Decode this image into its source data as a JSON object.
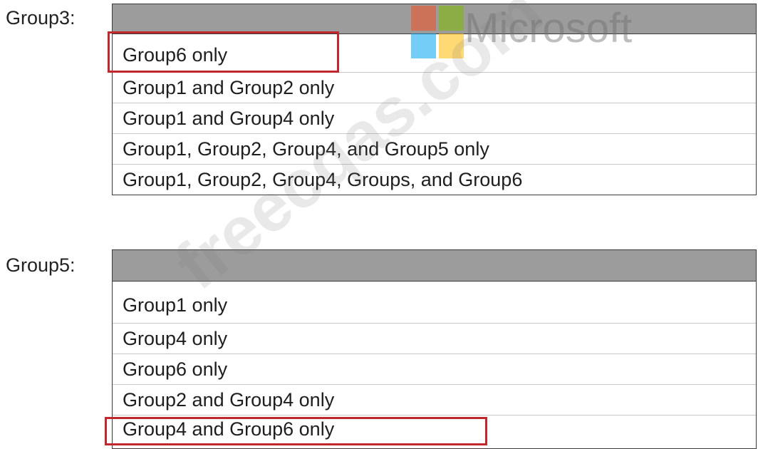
{
  "groups": [
    {
      "label": "Group3:",
      "options": [
        "Group6 only",
        "Group1 and Group2 only",
        "Group1 and Group4 only",
        "Group1, Group2, Group4, and Group5 only",
        "Group1, Group2, Group4, Groups, and Group6"
      ],
      "selected": "Group6 only"
    },
    {
      "label": "Group5:",
      "options": [
        "Group1 only",
        "Group4 only",
        "Group6 only",
        "Group2 and Group4 only",
        "Group4 and Group6 only"
      ],
      "selected": "Group4 and Group6 only"
    }
  ],
  "watermark": {
    "brand": "Microsoft",
    "site": "freecqas.com"
  },
  "colors": {
    "header_fill": "#9c9c9c",
    "highlight": "#c0282d",
    "ms_red": "#f25022",
    "ms_green": "#7fba00",
    "ms_blue": "#00a4ef",
    "ms_yellow": "#ffb900"
  }
}
